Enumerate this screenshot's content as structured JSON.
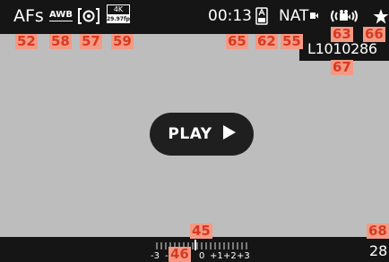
{
  "top_bar": {
    "focus_mode": "AFs",
    "white_balance": "AWB",
    "metering_icon": "spot-metering-icon",
    "video_format": {
      "resolution": "4K",
      "framerate": "29.97fps"
    },
    "recording_time": "00:13",
    "iso_icon": "auto-iso-icon",
    "film_style": "NAT",
    "audio_icon": "video-audio-icon",
    "favorite_icon": "star-icon"
  },
  "file_name": "L1010286",
  "play_button": {
    "label": "PLAY",
    "icon": "play-triangle-icon"
  },
  "bottom_bar": {
    "exposure_scale_labels": [
      "-3",
      "-2",
      "-1",
      "0",
      "+1",
      "+2",
      "+3"
    ],
    "frame_count": "28"
  },
  "callouts": {
    "c52": "52",
    "c58": "58",
    "c57": "57",
    "c59": "59",
    "c65": "65",
    "c62": "62",
    "c55": "55",
    "c63": "63",
    "c66": "66",
    "c67": "67",
    "c45": "45",
    "c46": "46",
    "c68": "68"
  },
  "colors": {
    "bar_background": "#151515",
    "screen_background": "#bdbdbd",
    "callout_fill": "#f39a86",
    "callout_text": "#d83a1f"
  }
}
